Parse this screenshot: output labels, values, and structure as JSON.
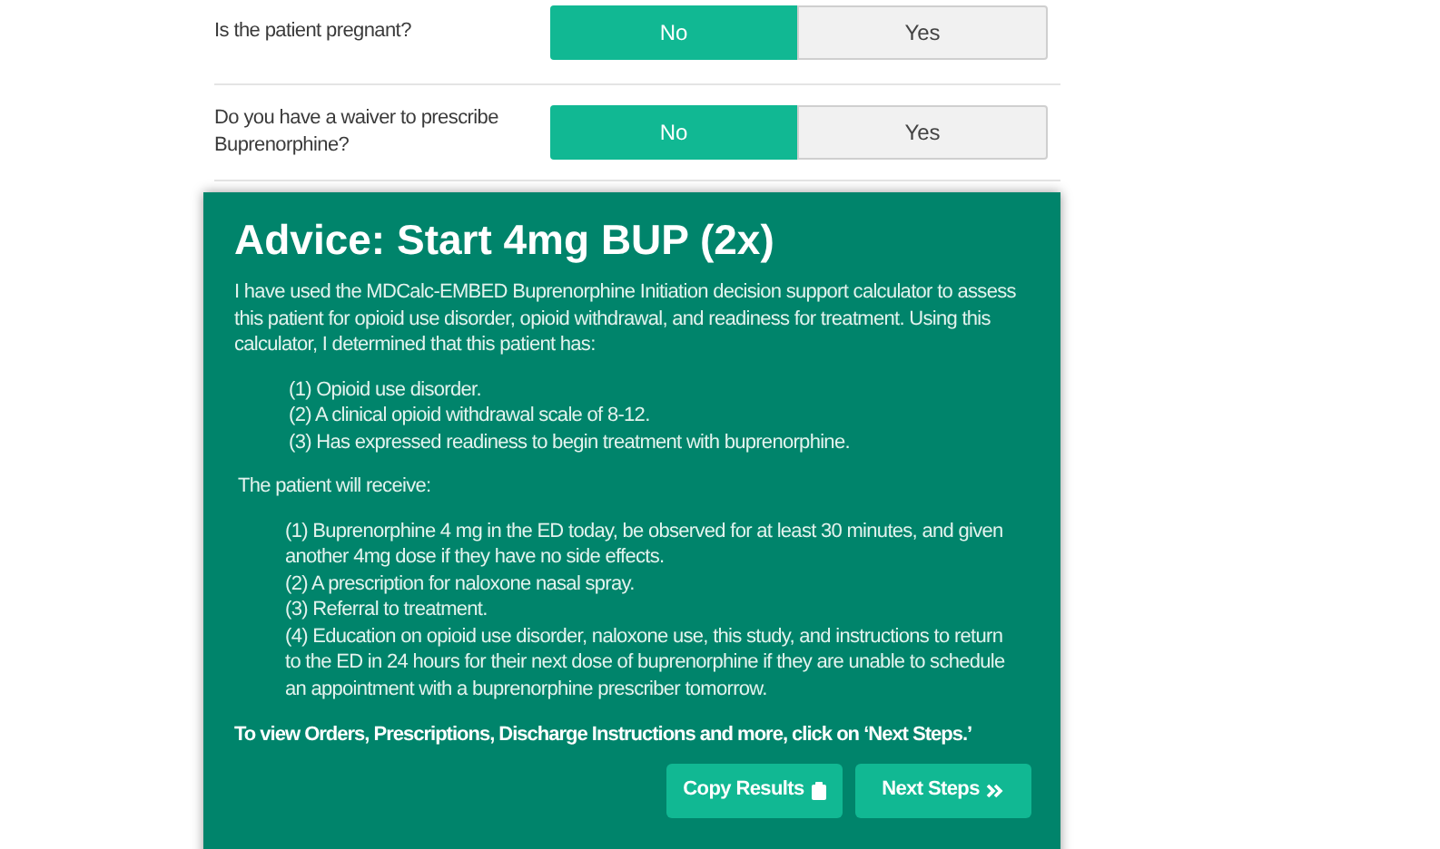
{
  "questions": [
    {
      "label": "Is the patient pregnant?",
      "options": [
        {
          "label": "No",
          "selected": true
        },
        {
          "label": "Yes",
          "selected": false
        }
      ]
    },
    {
      "label": "Do you have a waiver to prescribe Buprenorphine?",
      "options": [
        {
          "label": "No",
          "selected": true
        },
        {
          "label": "Yes",
          "selected": false
        }
      ]
    }
  ],
  "advice": {
    "title": "Advice: Start 4mg BUP (2x)",
    "intro": "I have used the MDCalc-EMBED Buprenorphine Initiation decision support calculator to assess this patient for opioid use disorder, opioid withdrawal, and readiness for treatment. Using this calculator, I determined that this patient has:",
    "findings": [
      "(1) Opioid use disorder.",
      "(2) A clinical opioid withdrawal scale of 8-12.",
      "(3) Has expressed readiness to begin treatment with buprenorphine."
    ],
    "receive_heading": "The patient will receive:",
    "plan": [
      "(1) Buprenorphine 4 mg in the ED today, be observed for at least 30 minutes, and given another 4mg dose if they have no side effects.",
      "(2) A prescription for naloxone nasal spray.",
      "(3) Referral to treatment.",
      "(4) Education on opioid use disorder, naloxone use, this study, and instructions to return to the ED in 24 hours for their next dose of buprenorphine if they are unable to schedule an appointment with a buprenorphine prescriber tomorrow."
    ],
    "next_note": "To view Orders, Prescriptions, Discharge Instructions and more, click on ‘Next Steps.’",
    "buttons": [
      {
        "label": "Copy Results",
        "kind": "copy"
      },
      {
        "label": "Next Steps",
        "kind": "next"
      }
    ]
  }
}
